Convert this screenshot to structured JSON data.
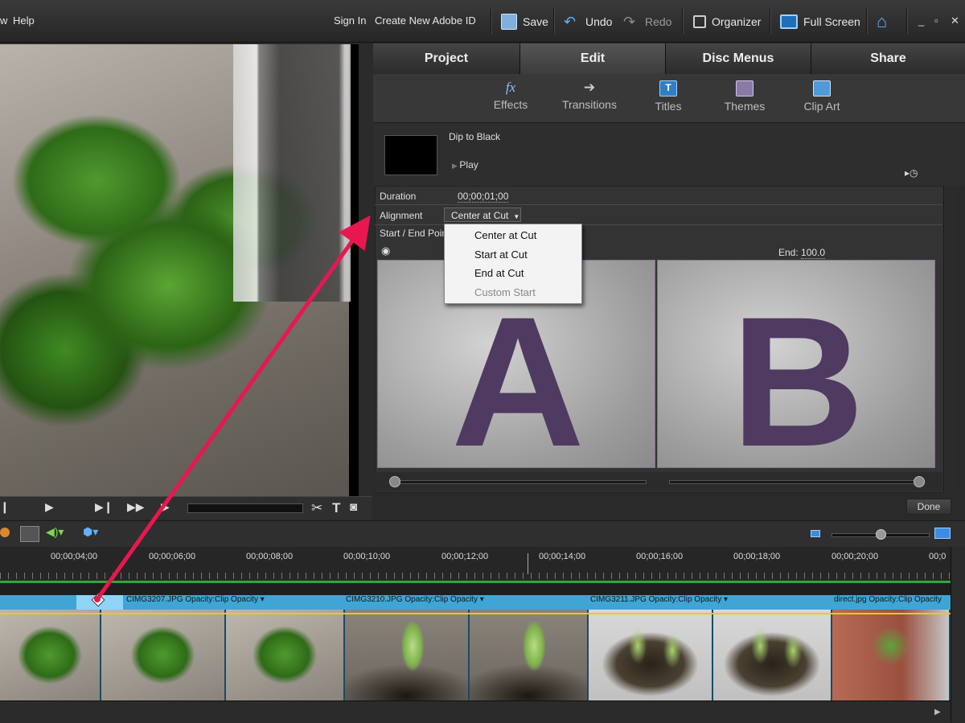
{
  "menubar": {
    "view_partial": "w",
    "help": "Help"
  },
  "topbar": {
    "sign_in": "Sign In",
    "create_id": "Create New Adobe ID",
    "save": "Save",
    "undo": "Undo",
    "redo": "Redo",
    "organizer": "Organizer",
    "full_screen": "Full Screen"
  },
  "window_controls": {
    "minimize": "_",
    "maximize": "▫",
    "close": "✕"
  },
  "tabs": [
    "Project",
    "Edit",
    "Disc Menus",
    "Share"
  ],
  "active_tab": "Edit",
  "subtools": [
    "Effects",
    "Transitions",
    "Titles",
    "Themes",
    "Clip Art"
  ],
  "transition": {
    "name": "Dip to Black",
    "play": "Play"
  },
  "properties": {
    "duration_label": "Duration",
    "duration_value": "00;00;01;00",
    "alignment_label": "Alignment",
    "alignment_value": "Center at Cut",
    "start_end_label": "Start / End Points",
    "end_label": "End:",
    "end_value": "100.0"
  },
  "alignment_options": [
    "Center at Cut",
    "Start at Cut",
    "End at Cut",
    "Custom Start"
  ],
  "preview_letters": {
    "a": "A",
    "b": "B"
  },
  "done_button": "Done",
  "timeline": {
    "ticks": [
      "00;00;04;00",
      "00;00;06;00",
      "00;00;08;00",
      "00;00;10;00",
      "00;00;12;00",
      "00;00;14;00",
      "00;00;16;00",
      "00;00;18;00",
      "00;00;20;00",
      "00;0"
    ],
    "clips": [
      {
        "name": "CIMG3207.JPG",
        "effect": "Opacity:Clip Opacity ▾"
      },
      {
        "name": "CIMG3210.JPG",
        "effect": "Opacity:Clip Opacity ▾"
      },
      {
        "name": "CIMG3211.JPG",
        "effect": "Opacity:Clip Opacity ▾"
      },
      {
        "name": "direct.jpg",
        "effect": "Opacity:Clip Opacity"
      }
    ]
  },
  "colors": {
    "accent_blue": "#3fa5d4",
    "arrow": "#e8174f",
    "timeline_green": "#2ea83a"
  }
}
